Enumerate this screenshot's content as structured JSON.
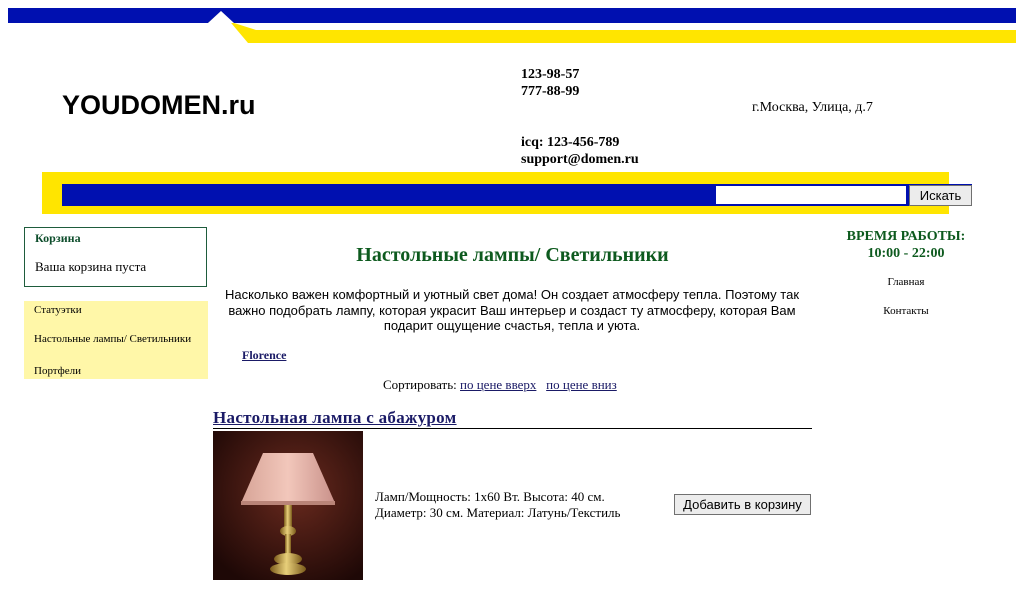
{
  "header": {
    "logo": "YOUDOMEN.ru",
    "phone1": "123-98-57",
    "phone2": "777-88-99",
    "icq": "icq: 123-456-789",
    "email": "support@domen.ru",
    "address": "г.Москва, Улица, д.7"
  },
  "search": {
    "placeholder": "",
    "button_label": "Искать"
  },
  "cart": {
    "title": "Корзина",
    "empty_text": "Ваша корзина пуста"
  },
  "categories": [
    {
      "label": "Статуэтки"
    },
    {
      "label": "Настольные лампы/ Светильники"
    },
    {
      "label": "Портфели"
    }
  ],
  "main": {
    "page_title": "Настольные лампы/ Светильники",
    "intro": "Насколько важен комфортный и уютный свет дома! Он создает атмосферу тепла. Поэтому так важно подобрать лампу, которая украсит Ваш интерьер и создаст ту атмосферу, которая Вам подарит ощущение счастья, тепла и уюта.",
    "brand_link": "Florence",
    "sort_label": "Сортировать:",
    "sort_up": "по цене вверх",
    "sort_down": "по цене вниз"
  },
  "product": {
    "title": "Настольная лампа с абажуром",
    "desc_line1": "Ламп/Мощность: 1x60 Вт. Высота: 40 см.",
    "desc_line2": "Диаметр: 30 см. Материал: Латунь/Текстиль",
    "add_button": "Добавить в корзину"
  },
  "sidebar_right": {
    "hours_title": "ВРЕМЯ РАБОТЫ:",
    "hours": "10:00 - 22:00",
    "links": [
      {
        "label": "Главная"
      },
      {
        "label": "Контакты"
      }
    ]
  },
  "colors": {
    "blue": "#0010b0",
    "yellow": "#ffe500",
    "green_heading": "#0d5a1e",
    "link": "#1a1a66",
    "category_bg": "#fff7a8"
  }
}
